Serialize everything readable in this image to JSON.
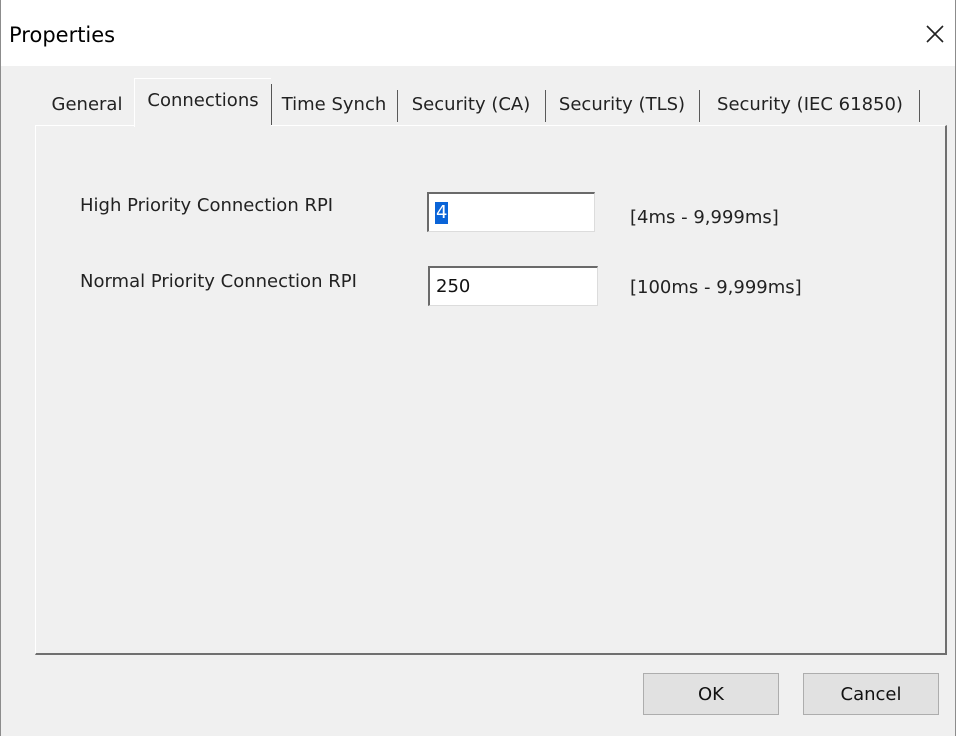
{
  "window": {
    "title": "Properties",
    "close_icon": "close-icon"
  },
  "tabs": [
    {
      "label": "General",
      "active": false
    },
    {
      "label": "Connections",
      "active": true
    },
    {
      "label": "Time Synch",
      "active": false
    },
    {
      "label": "Security (CA)",
      "active": false
    },
    {
      "label": "Security (TLS)",
      "active": false
    },
    {
      "label": "Security (IEC 61850)",
      "active": false
    }
  ],
  "connections": {
    "high_priority": {
      "label": "High Priority Connection RPI",
      "value": "4",
      "range": "[4ms - 9,999ms]"
    },
    "normal_priority": {
      "label": "Normal Priority Connection RPI",
      "value": "250",
      "range": "[100ms - 9,999ms]"
    }
  },
  "buttons": {
    "ok": "OK",
    "cancel": "Cancel"
  },
  "colors": {
    "window_bg": "#f0f0f0",
    "titlebar_bg": "#ffffff",
    "selection": "#0a64d8",
    "button_bg": "#e1e1e1"
  }
}
